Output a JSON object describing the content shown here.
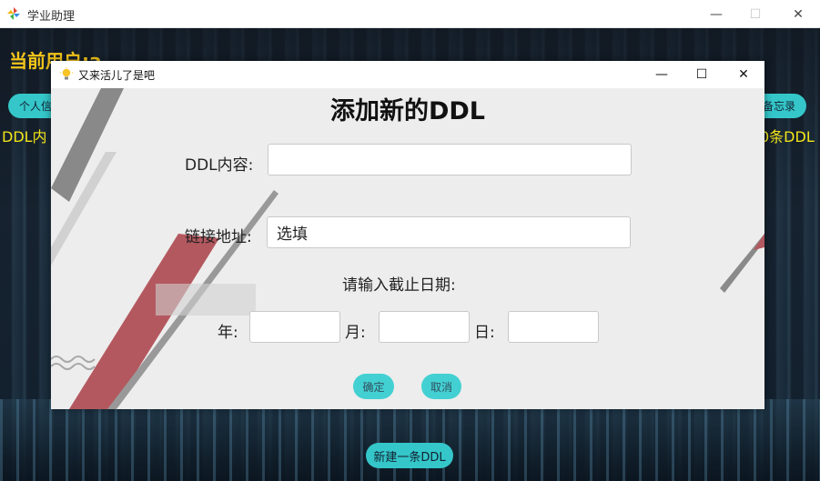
{
  "main_window": {
    "title": "学业助理",
    "current_user": "当前用户:a",
    "left_button": "个人信",
    "right_button": "备忘录",
    "ddl_left": "DDL内",
    "ddl_right": "0条DDL",
    "new_ddl_button": "新建一条DDL"
  },
  "dialog": {
    "title": "又来活儿了是吧",
    "heading": "添加新的DDL",
    "ddl_content_label": "DDL内容:",
    "ddl_content_value": "",
    "link_label": "链接地址:",
    "link_value": "选填",
    "deadline_prompt": "请输入截止日期:",
    "year_label": "年:",
    "month_label": "月:",
    "day_label": "日:",
    "year_value": "",
    "month_value": "",
    "day_value": "",
    "confirm_button": "确定",
    "cancel_button": "取消"
  },
  "colors": {
    "accent": "#43d0d2",
    "user_text": "#f3c51a",
    "ddl_text": "#f3e51a"
  }
}
